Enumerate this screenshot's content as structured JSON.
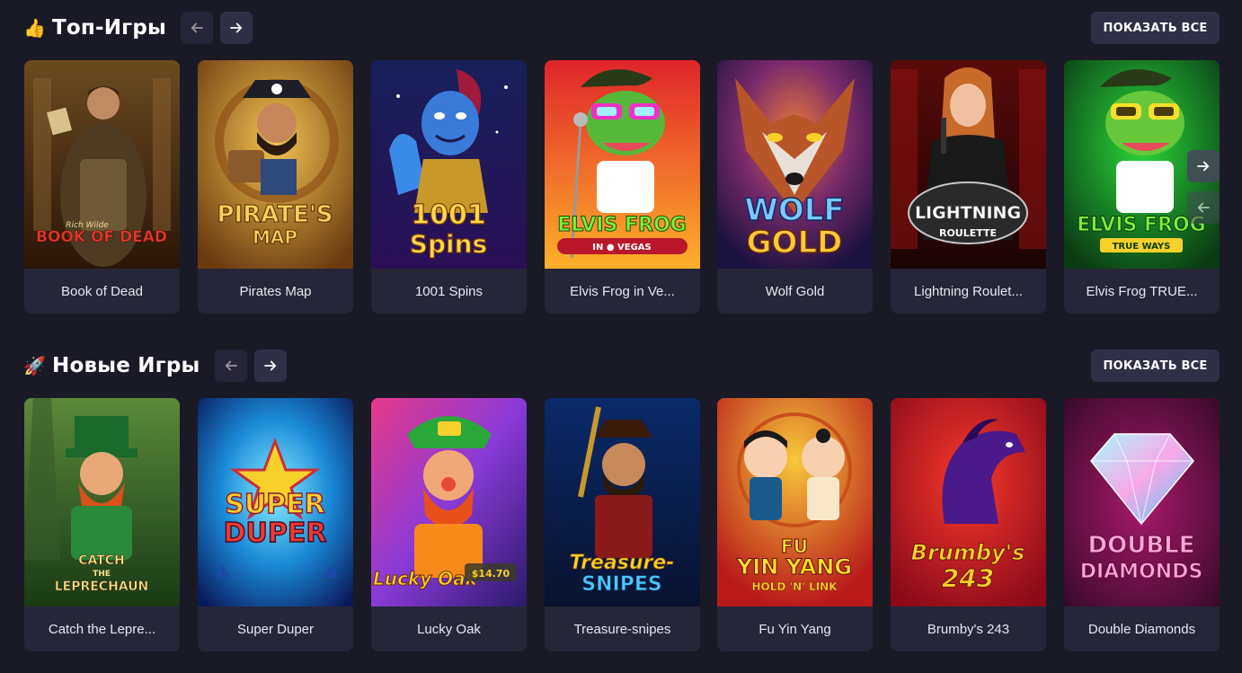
{
  "sections": [
    {
      "emoji": "👍",
      "title": "Топ-Игры",
      "show_all": "ПОКАЗАТЬ ВСЕ",
      "games": [
        {
          "name": "Book of Dead",
          "art": "Rich Wilde BOOK OF DEAD"
        },
        {
          "name": "Pirates Map",
          "art": "PIRATE'S MAP"
        },
        {
          "name": "1001 Spins",
          "art": "1001 Spins"
        },
        {
          "name": "Elvis Frog in Ve...",
          "art": "ELVIS FROG IN VEGAS"
        },
        {
          "name": "Wolf Gold",
          "art": "WOLF GOLD"
        },
        {
          "name": "Lightning Roulet...",
          "art": "LIGHTNING ROULETTE"
        },
        {
          "name": "Elvis Frog TRUE...",
          "art": "ELVIS FROG TRUE WAYS"
        }
      ]
    },
    {
      "emoji": "🚀",
      "title": "Новые Игры",
      "show_all": "ПОКАЗАТЬ ВСЕ",
      "games": [
        {
          "name": "Catch the Lepre...",
          "art": "CATCH THE LEPRECHAUN"
        },
        {
          "name": "Super Duper",
          "art": "SUPER DUPER"
        },
        {
          "name": "Lucky Oak",
          "art": "Lucky Oak",
          "badge": "$14.70"
        },
        {
          "name": "Treasure-snipes",
          "art": "Treasure-SNIPES"
        },
        {
          "name": "Fu Yin Yang",
          "art": "FU YIN YANG HOLD 'N' LINK"
        },
        {
          "name": "Brumby's 243",
          "art": "Brumby's 243"
        },
        {
          "name": "Double Diamonds",
          "art": "DOUBLE DIAMONDS"
        }
      ]
    }
  ],
  "colors": {
    "background": "#1a1a27",
    "card": "#262638",
    "button": "#2f2f45"
  },
  "icons": {
    "prev": "arrow-left-icon",
    "next": "arrow-right-icon"
  }
}
